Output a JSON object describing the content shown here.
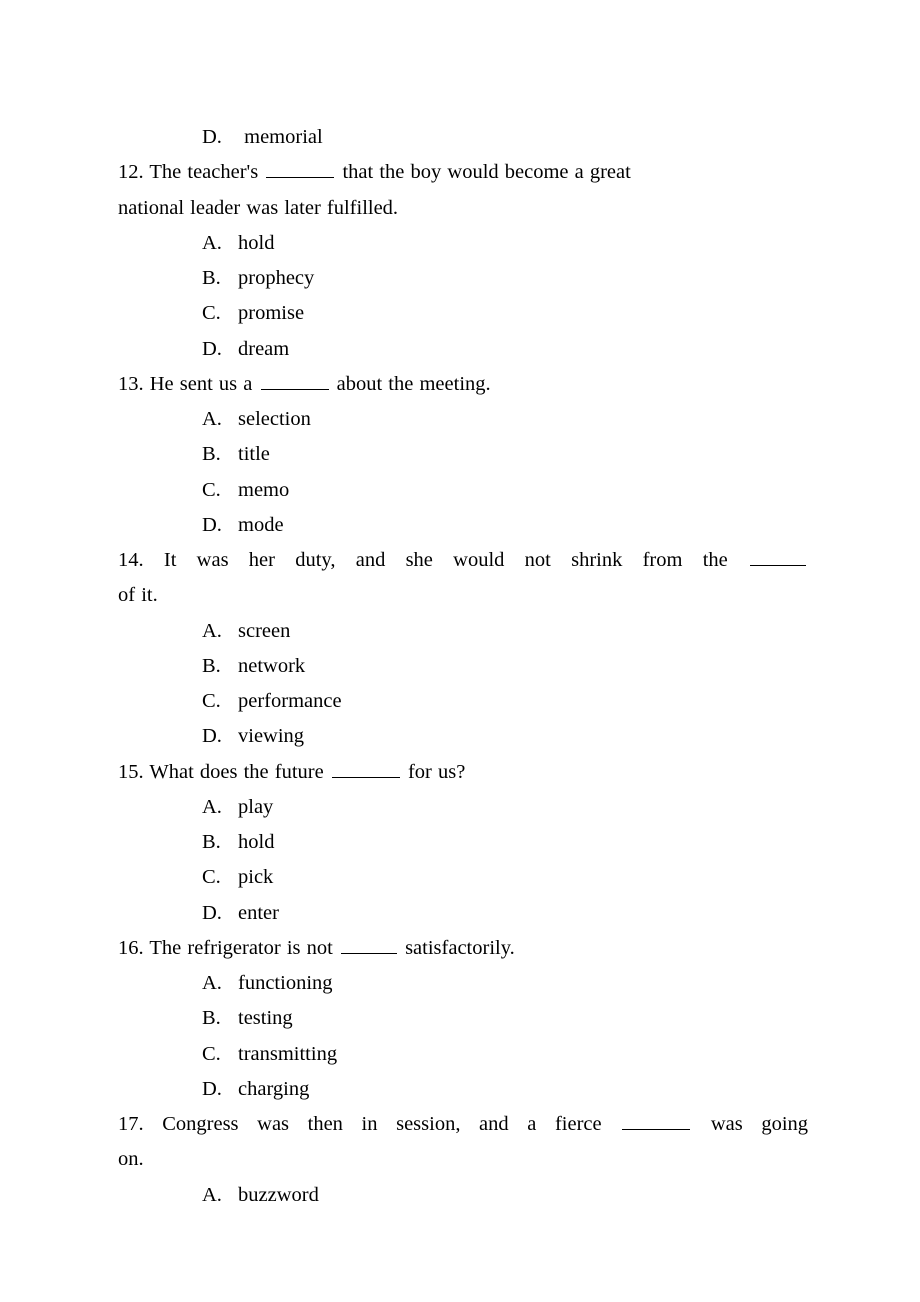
{
  "q11": {
    "options": {
      "D": "memorial"
    }
  },
  "q12": {
    "num": "12.",
    "pre": "The teacher's ",
    "post": " that the boy would become a great",
    "line2": "national leader was later fulfilled.",
    "blank_w": 68,
    "options": {
      "A": "hold",
      "B": "prophecy",
      "C": "promise",
      "D": "dream"
    }
  },
  "q13": {
    "num": "13.",
    "pre": "He sent us a ",
    "post": " about the meeting.",
    "blank_w": 68,
    "options": {
      "A": "selection",
      "B": "title",
      "C": "memo",
      "D": "mode"
    }
  },
  "q14": {
    "num": "14.",
    "pre": "It was her duty, and she would not shrink from the ",
    "blank_w": 56,
    "line2": "of it.",
    "options": {
      "A": "screen",
      "B": "network",
      "C": "performance",
      "D": "viewing"
    }
  },
  "q15": {
    "num": "15.",
    "pre": "What does the future ",
    "post": " for us?",
    "blank_w": 68,
    "options": {
      "A": "play",
      "B": "hold",
      "C": "pick",
      "D": "enter"
    }
  },
  "q16": {
    "num": "16.",
    "pre": "The refrigerator is not ",
    "post": " satisfactorily.",
    "blank_w": 56,
    "options": {
      "A": "functioning",
      "B": "testing",
      "C": "transmitting",
      "D": "charging"
    }
  },
  "q17": {
    "num": "17.",
    "pre": "Congress was then in session, and a fierce ",
    "post": " was going",
    "blank_w": 68,
    "line2": "on.",
    "options": {
      "A": "buzzword"
    }
  }
}
